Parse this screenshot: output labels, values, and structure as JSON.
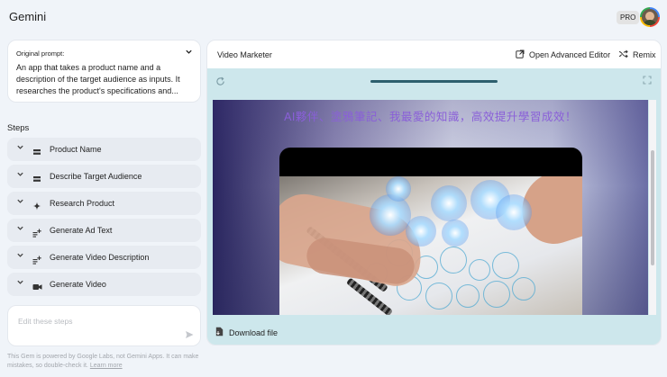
{
  "app": {
    "title": "Gemini",
    "badge": "PRO"
  },
  "prompt": {
    "label": "Original prompt:",
    "text": "An app that takes a product name and a description of the target audience as inputs. It researches the product's specifications and..."
  },
  "steps": {
    "heading": "Steps",
    "items": [
      {
        "label": "Product Name",
        "icon": "short-text-icon"
      },
      {
        "label": "Describe Target Audience",
        "icon": "short-text-icon"
      },
      {
        "label": "Research Product",
        "icon": "sparkle-icon"
      },
      {
        "label": "Generate Ad Text",
        "icon": "text-generate-icon"
      },
      {
        "label": "Generate Video Description",
        "icon": "text-generate-icon"
      },
      {
        "label": "Generate Video",
        "icon": "video-camera-icon"
      }
    ]
  },
  "editor": {
    "placeholder": "Edit these steps"
  },
  "disclaimer": {
    "text": "This Gem is powered by Google Labs, not Gemini Apps. It can make mistakes, so double-check it.",
    "link": "Learn more"
  },
  "panel": {
    "title": "Video Marketer",
    "open_editor": "Open Advanced Editor",
    "remix": "Remix",
    "caption": "AI夥伴、塗鴉筆記、我最愛的知識，高效提升學習成效！",
    "download": "Download file"
  },
  "colors": {
    "background": "#f0f4f9",
    "preview_bg": "#cde7ec",
    "caption": "#8a5fd8",
    "progress": "#2d5f6e"
  }
}
